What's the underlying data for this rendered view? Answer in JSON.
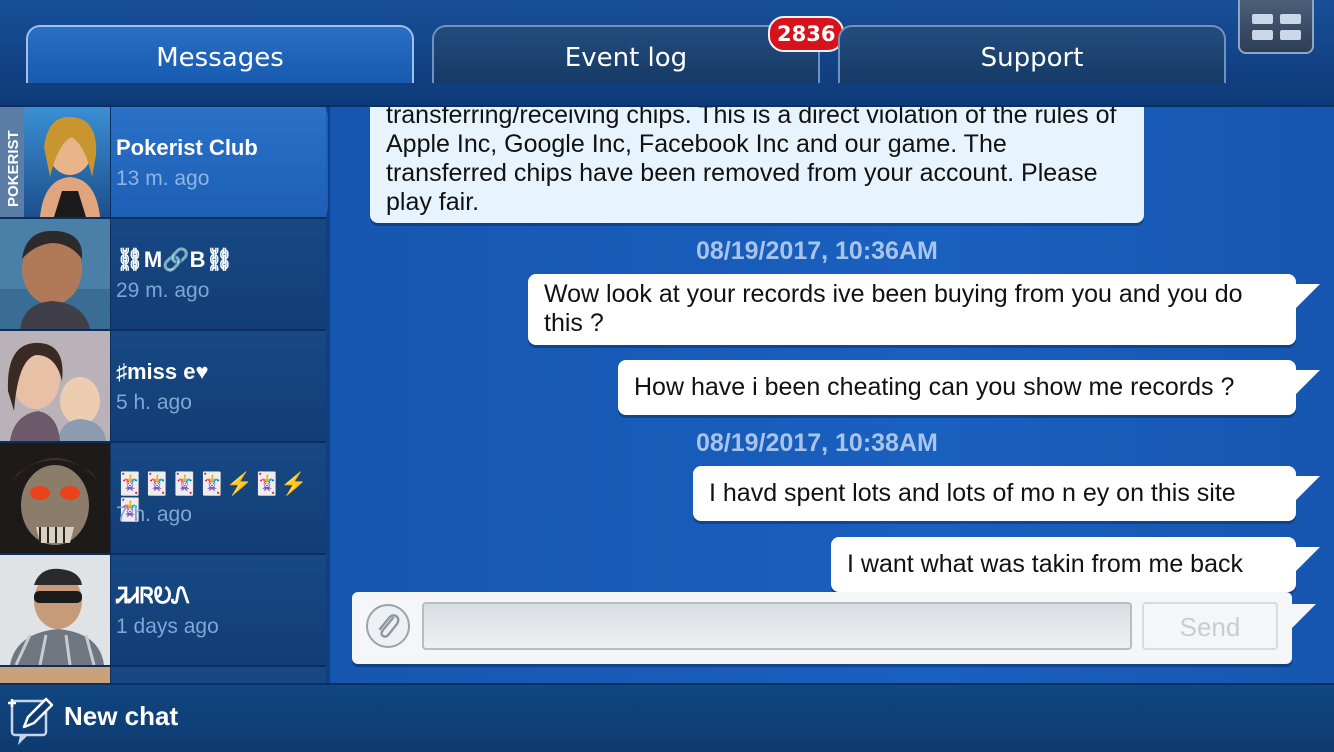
{
  "tabs": [
    {
      "label": "Messages",
      "active": true
    },
    {
      "label": "Event log",
      "badge": "2836"
    },
    {
      "label": "Support"
    }
  ],
  "contacts": [
    {
      "name": "Pokerist Club",
      "time": "13 m. ago",
      "active": true,
      "avatar_text": "POKERIST"
    },
    {
      "name": "⛓M🔗B⛓",
      "time": "29 m. ago"
    },
    {
      "name": "♯miss e♥",
      "time": "5 h. ago"
    },
    {
      "name": "🃏🃏🃏🃏⚡🃏⚡🃏",
      "time": "7 h. ago"
    },
    {
      "name": "ᏘᏗᏒᎧᏁ",
      "time": "1 days ago"
    }
  ],
  "messages": [
    {
      "type": "incoming",
      "text": "transferring/receiving chips. This is a direct violation of the rules of Apple Inc, Google Inc, Facebook Inc and our game. The transferred chips have been removed from your account. Please play fair."
    },
    {
      "type": "timestamp",
      "text": "08/19/2017, 10:36AM"
    },
    {
      "type": "outgoing",
      "text": "Wow look at your records ive been buying from you and you do this ?"
    },
    {
      "type": "outgoing",
      "text": "How have i been cheating can you show me records ?"
    },
    {
      "type": "timestamp",
      "text": "08/19/2017, 10:38AM"
    },
    {
      "type": "outgoing",
      "text": "I havd spent lots and lots of mo n ey on this site"
    },
    {
      "type": "outgoing",
      "text": "I want what was takin from me back"
    }
  ],
  "composer": {
    "placeholder": "",
    "send_label": "Send"
  },
  "footer": {
    "new_chat_label": "New chat"
  },
  "colors": {
    "accent": "#1a60bf",
    "badge": "#d8121a"
  }
}
